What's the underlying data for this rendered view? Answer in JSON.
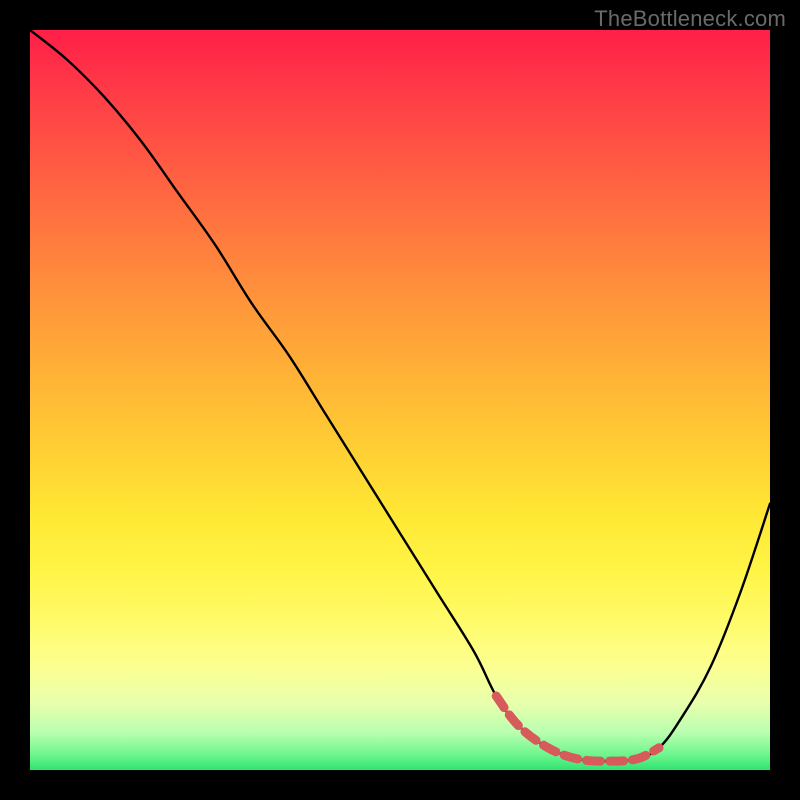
{
  "watermark": "TheBottleneck.com",
  "chart_data": {
    "type": "line",
    "title": "",
    "xlabel": "",
    "ylabel": "",
    "xlim": [
      0,
      100
    ],
    "ylim": [
      0,
      100
    ],
    "series": [
      {
        "name": "main-curve",
        "x": [
          0,
          5,
          10,
          15,
          20,
          25,
          30,
          35,
          40,
          45,
          50,
          55,
          60,
          63,
          66,
          70,
          74,
          78,
          82,
          85,
          88,
          92,
          96,
          100
        ],
        "y": [
          100,
          96,
          91,
          85,
          78,
          71,
          63,
          56,
          48,
          40,
          32,
          24,
          16,
          10,
          6,
          3,
          1.5,
          1.2,
          1.5,
          3,
          7,
          14,
          24,
          36
        ]
      },
      {
        "name": "highlight-band",
        "x": [
          63,
          66,
          70,
          74,
          78,
          82,
          85
        ],
        "y": [
          10,
          6,
          3,
          1.5,
          1.2,
          1.5,
          3
        ]
      }
    ],
    "annotations": []
  }
}
